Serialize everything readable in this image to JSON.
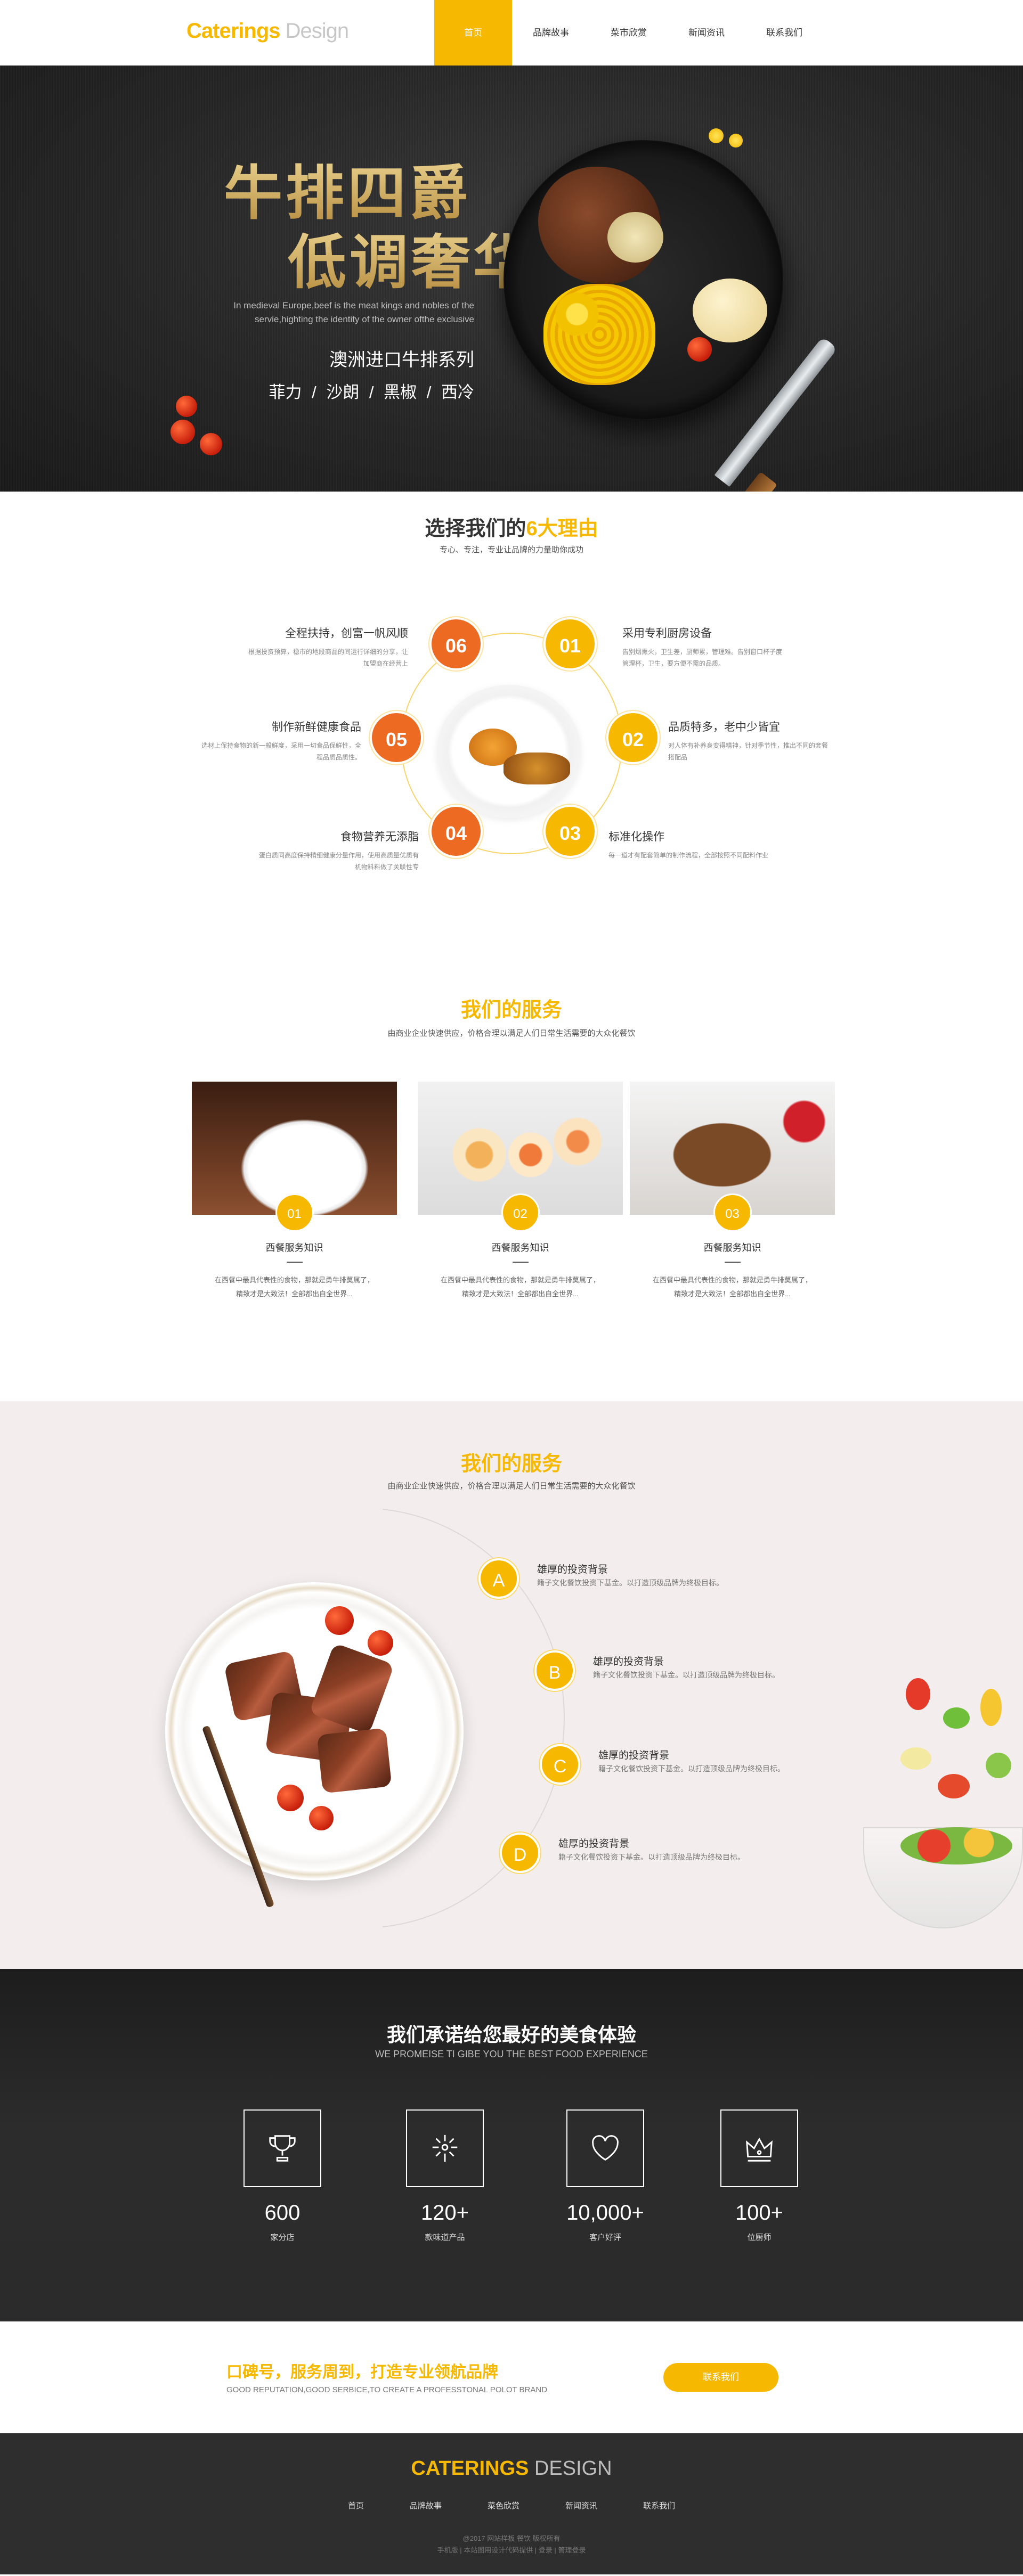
{
  "header": {
    "logo_a": "Caterings",
    "logo_b": "Design",
    "nav": [
      "首页",
      "品牌故事",
      "菜市欣赏",
      "新闻资讯",
      "联系我们"
    ]
  },
  "hero": {
    "title1": "牛排四爵",
    "title2": "低调奢华",
    "en": "In medieval Europe,beef is the meat kings and nobles of the servie,highting the identity of the owner ofthe exclusive",
    "subtitle": "澳洲进口牛排系列",
    "tags": "菲力 / 沙朗 / 黑椒 / 西冷"
  },
  "reasons": {
    "title_a": "选择我们的",
    "title_b": "6大理由",
    "subtitle": "专心、专注，专业让品牌的力量助你成功",
    "items": [
      {
        "num": "01",
        "title": "采用专利厨房设备",
        "desc": "告别烟熏火，卫生差，厨师累，管理难。告别窗口杯子度管理杯，卫生，要方便不需的品质。"
      },
      {
        "num": "02",
        "title": "品质特多，老中少皆宜",
        "desc": "对人体有补养身变得精神，针对季节性，推出不同的套餐搭配品"
      },
      {
        "num": "03",
        "title": "标准化操作",
        "desc": "每一道才有配套简单的制作流程，全部按照不同配料作业"
      },
      {
        "num": "04",
        "title": "食物营养无添脂",
        "desc": "蛋白质同高度保持精细健康分量作用，使用高质量优质有机物料料做了关联性专"
      },
      {
        "num": "05",
        "title": "制作新鲜健康食品",
        "desc": "选材上保持食物的新一般鲜度，采用一切食品保鲜性，全程品质品质性。"
      },
      {
        "num": "06",
        "title": "全程扶持，创富一帆风顺",
        "desc": "根据投资预算，稳市的地段商品的同运行详细的分享，让加盟商在经营上"
      }
    ]
  },
  "services": {
    "title": "我们的服务",
    "subtitle": "由商业企业快速供应，价格合理以满足人们日常生活需要的大众化餐饮",
    "cards": [
      {
        "num": "01",
        "title": "西餐服务知识",
        "desc": "在西餐中最具代表性的食物，那就是勇牛排莫属了，精致才是大致法！全部都出自全世界..."
      },
      {
        "num": "02",
        "title": "西餐服务知识",
        "desc": "在西餐中最具代表性的食物，那就是勇牛排莫属了，精致才是大致法！全部都出自全世界..."
      },
      {
        "num": "03",
        "title": "西餐服务知识",
        "desc": "在西餐中最具代表性的食物，那就是勇牛排莫属了，精致才是大致法！全部都出自全世界..."
      }
    ]
  },
  "services2": {
    "title": "我们的服务",
    "subtitle": "由商业企业快速供应，价格合理以满足人们日常生活需要的大众化餐饮",
    "steps": [
      {
        "letter": "A",
        "title": "雄厚的投资背景",
        "desc": "籍子文化餐饮投资下基金。以打造顶级品牌为终极目标。"
      },
      {
        "letter": "B",
        "title": "雄厚的投资背景",
        "desc": "籍子文化餐饮投资下基金。以打造顶级品牌为终极目标。"
      },
      {
        "letter": "C",
        "title": "雄厚的投资背景",
        "desc": "籍子文化餐饮投资下基金。以打造顶级品牌为终极目标。"
      },
      {
        "letter": "D",
        "title": "雄厚的投资背景",
        "desc": "籍子文化餐饮投资下基金。以打造顶级品牌为终极目标。"
      }
    ]
  },
  "promise": {
    "title": "我们承诺给您最好的美食体验",
    "en": "WE PROMEISE TI GIBE YOU THE BEST FOOD EXPERIENCE",
    "stats": [
      {
        "icon": "trophy-icon",
        "value": "600",
        "label": "家分店"
      },
      {
        "icon": "fireworks-icon",
        "value": "120+",
        "label": "款味道产品"
      },
      {
        "icon": "heart-icon",
        "value": "10,000+",
        "label": "客户好评"
      },
      {
        "icon": "crown-icon",
        "value": "100+",
        "label": "位厨师"
      }
    ]
  },
  "cta": {
    "title": "口碑号，服务周到，打造专业领航品牌",
    "subtitle": "GOOD REPUTATION,GOOD SERBICE,TO CREATE A PROFESSTONAL POLOT BRAND",
    "button": "联系我们"
  },
  "footer": {
    "logo_a": "CATERINGS",
    "logo_b": "DESIGN",
    "nav": [
      "首页",
      "品牌故事",
      "菜色欣赏",
      "新闻资讯",
      "联系我们"
    ],
    "copy1": "@2017 网站样板 餐饮 版权所有",
    "copy2": "手机版 | 本站图用设计代码提供 | 登录 | 管理登录"
  },
  "colors": {
    "accent": "#f6b800",
    "orange": "#ec6a21",
    "dark": "#2b2b2b"
  }
}
